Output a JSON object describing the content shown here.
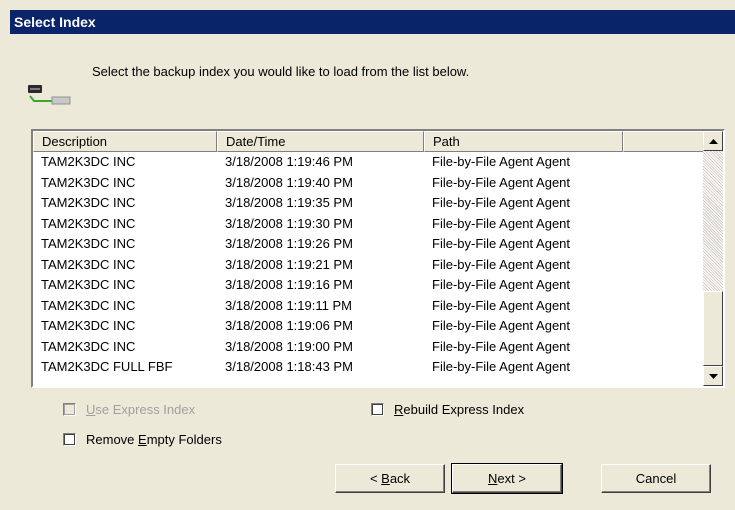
{
  "window": {
    "title": "Select Index"
  },
  "header": {
    "instruction": "Select the backup index you would like to load from the list below.",
    "icon": "tape-drive-icon"
  },
  "list": {
    "columns": [
      "Description",
      "Date/Time",
      "Path",
      ""
    ],
    "rows": [
      {
        "description": "TAM2K3DC INC",
        "datetime": "3/18/2008 1:19:46 PM",
        "path": "File-by-File Agent Agent"
      },
      {
        "description": "TAM2K3DC INC",
        "datetime": "3/18/2008 1:19:40 PM",
        "path": "File-by-File Agent Agent"
      },
      {
        "description": "TAM2K3DC INC",
        "datetime": "3/18/2008 1:19:35 PM",
        "path": "File-by-File Agent Agent"
      },
      {
        "description": "TAM2K3DC INC",
        "datetime": "3/18/2008 1:19:30 PM",
        "path": "File-by-File Agent Agent"
      },
      {
        "description": "TAM2K3DC INC",
        "datetime": "3/18/2008 1:19:26 PM",
        "path": "File-by-File Agent Agent"
      },
      {
        "description": "TAM2K3DC INC",
        "datetime": "3/18/2008 1:19:21 PM",
        "path": "File-by-File Agent Agent"
      },
      {
        "description": "TAM2K3DC INC",
        "datetime": "3/18/2008 1:19:16 PM",
        "path": "File-by-File Agent Agent"
      },
      {
        "description": "TAM2K3DC INC",
        "datetime": "3/18/2008 1:19:11 PM",
        "path": "File-by-File Agent Agent"
      },
      {
        "description": "TAM2K3DC INC",
        "datetime": "3/18/2008 1:19:06 PM",
        "path": "File-by-File Agent Agent"
      },
      {
        "description": "TAM2K3DC INC",
        "datetime": "3/18/2008 1:19:00 PM",
        "path": "File-by-File Agent Agent"
      },
      {
        "description": "TAM2K3DC FULL FBF",
        "datetime": "3/18/2008 1:18:43 PM",
        "path": "File-by-File Agent Agent"
      }
    ]
  },
  "options": {
    "use_express_index": {
      "mnemonic": "U",
      "rest": "se Express Index",
      "checked": false,
      "enabled": false
    },
    "rebuild_express_index": {
      "mnemonic": "R",
      "rest": "ebuild Express Index",
      "checked": false,
      "enabled": true
    },
    "remove_empty_folders": {
      "before": "Remove ",
      "mnemonic": "E",
      "rest": "mpty Folders",
      "checked": false,
      "enabled": true
    }
  },
  "buttons": {
    "back": {
      "before": "< ",
      "mnemonic": "B",
      "rest": "ack"
    },
    "next": {
      "mnemonic": "N",
      "rest": "ext >"
    },
    "cancel": "Cancel"
  },
  "colors": {
    "title_bar": "#0a246a",
    "dialog_bg": "#ece9d8",
    "list_bg": "#ffffff"
  }
}
